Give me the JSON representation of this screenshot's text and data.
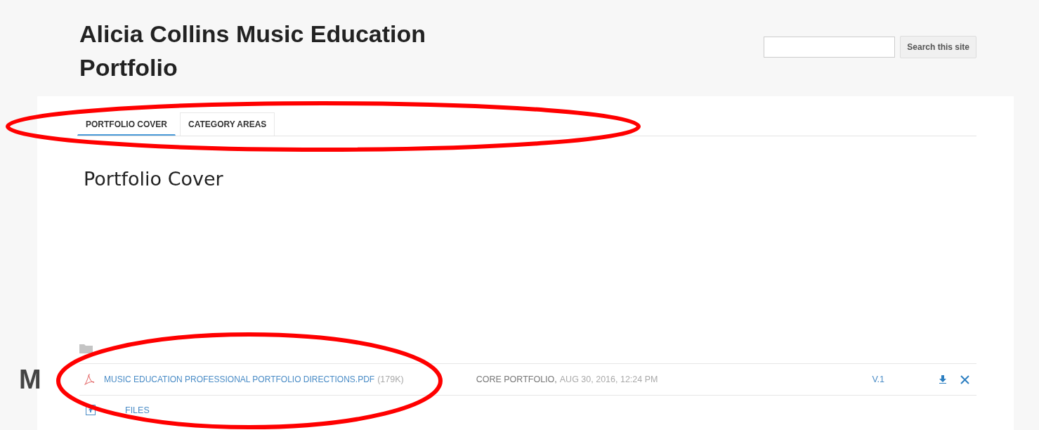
{
  "site": {
    "title": "Alicia Collins Music Education Portfolio",
    "search": {
      "button": "Search this site"
    }
  },
  "tabs": [
    {
      "label": "PORTFOLIO COVER",
      "selected": true
    },
    {
      "label": "CATEGORY AREAS",
      "selected": false
    }
  ],
  "page_title": "Portfolio Cover",
  "side_letter": "M",
  "files": [
    {
      "name": "MUSIC EDUCATION PROFESSIONAL PORTFOLIO DIRECTIONS.PDF",
      "size": "(179K)",
      "folder": "CORE PORTFOLIO,",
      "date": "AUG 30, 2016, 12:24 PM",
      "version": "V.1"
    }
  ],
  "add_files": "FILES",
  "annotations": [
    {
      "kind": "ellipse",
      "color": "#ff0000"
    },
    {
      "kind": "ellipse",
      "color": "#ff0000"
    }
  ]
}
